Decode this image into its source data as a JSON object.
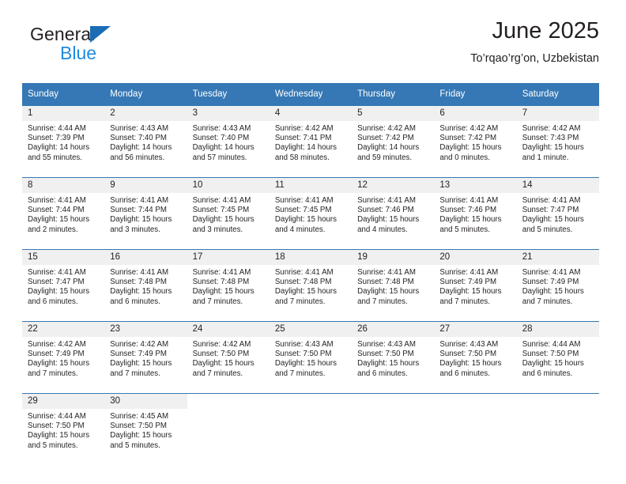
{
  "brand": {
    "name_top": "General",
    "name_bottom": "Blue",
    "triangle_color": "#1a6cb5",
    "blue_color": "#1f8ae0"
  },
  "header": {
    "title": "June 2025",
    "subtitle": "To’rqao’rg’on, Uzbekistan"
  },
  "theme": {
    "header_bg": "#3578b5",
    "daynum_bg": "#f0f0f0",
    "separator": "#3578b5",
    "text": "#231f20"
  },
  "calendar": {
    "weekday_headers": [
      "Sunday",
      "Monday",
      "Tuesday",
      "Wednesday",
      "Thursday",
      "Friday",
      "Saturday"
    ],
    "weeks": [
      [
        {
          "day": "1",
          "sunrise": "Sunrise: 4:44 AM",
          "sunset": "Sunset: 7:39 PM",
          "daylight1": "Daylight: 14 hours",
          "daylight2": "and 55 minutes."
        },
        {
          "day": "2",
          "sunrise": "Sunrise: 4:43 AM",
          "sunset": "Sunset: 7:40 PM",
          "daylight1": "Daylight: 14 hours",
          "daylight2": "and 56 minutes."
        },
        {
          "day": "3",
          "sunrise": "Sunrise: 4:43 AM",
          "sunset": "Sunset: 7:40 PM",
          "daylight1": "Daylight: 14 hours",
          "daylight2": "and 57 minutes."
        },
        {
          "day": "4",
          "sunrise": "Sunrise: 4:42 AM",
          "sunset": "Sunset: 7:41 PM",
          "daylight1": "Daylight: 14 hours",
          "daylight2": "and 58 minutes."
        },
        {
          "day": "5",
          "sunrise": "Sunrise: 4:42 AM",
          "sunset": "Sunset: 7:42 PM",
          "daylight1": "Daylight: 14 hours",
          "daylight2": "and 59 minutes."
        },
        {
          "day": "6",
          "sunrise": "Sunrise: 4:42 AM",
          "sunset": "Sunset: 7:42 PM",
          "daylight1": "Daylight: 15 hours",
          "daylight2": "and 0 minutes."
        },
        {
          "day": "7",
          "sunrise": "Sunrise: 4:42 AM",
          "sunset": "Sunset: 7:43 PM",
          "daylight1": "Daylight: 15 hours",
          "daylight2": "and 1 minute."
        }
      ],
      [
        {
          "day": "8",
          "sunrise": "Sunrise: 4:41 AM",
          "sunset": "Sunset: 7:44 PM",
          "daylight1": "Daylight: 15 hours",
          "daylight2": "and 2 minutes."
        },
        {
          "day": "9",
          "sunrise": "Sunrise: 4:41 AM",
          "sunset": "Sunset: 7:44 PM",
          "daylight1": "Daylight: 15 hours",
          "daylight2": "and 3 minutes."
        },
        {
          "day": "10",
          "sunrise": "Sunrise: 4:41 AM",
          "sunset": "Sunset: 7:45 PM",
          "daylight1": "Daylight: 15 hours",
          "daylight2": "and 3 minutes."
        },
        {
          "day": "11",
          "sunrise": "Sunrise: 4:41 AM",
          "sunset": "Sunset: 7:45 PM",
          "daylight1": "Daylight: 15 hours",
          "daylight2": "and 4 minutes."
        },
        {
          "day": "12",
          "sunrise": "Sunrise: 4:41 AM",
          "sunset": "Sunset: 7:46 PM",
          "daylight1": "Daylight: 15 hours",
          "daylight2": "and 4 minutes."
        },
        {
          "day": "13",
          "sunrise": "Sunrise: 4:41 AM",
          "sunset": "Sunset: 7:46 PM",
          "daylight1": "Daylight: 15 hours",
          "daylight2": "and 5 minutes."
        },
        {
          "day": "14",
          "sunrise": "Sunrise: 4:41 AM",
          "sunset": "Sunset: 7:47 PM",
          "daylight1": "Daylight: 15 hours",
          "daylight2": "and 5 minutes."
        }
      ],
      [
        {
          "day": "15",
          "sunrise": "Sunrise: 4:41 AM",
          "sunset": "Sunset: 7:47 PM",
          "daylight1": "Daylight: 15 hours",
          "daylight2": "and 6 minutes."
        },
        {
          "day": "16",
          "sunrise": "Sunrise: 4:41 AM",
          "sunset": "Sunset: 7:48 PM",
          "daylight1": "Daylight: 15 hours",
          "daylight2": "and 6 minutes."
        },
        {
          "day": "17",
          "sunrise": "Sunrise: 4:41 AM",
          "sunset": "Sunset: 7:48 PM",
          "daylight1": "Daylight: 15 hours",
          "daylight2": "and 7 minutes."
        },
        {
          "day": "18",
          "sunrise": "Sunrise: 4:41 AM",
          "sunset": "Sunset: 7:48 PM",
          "daylight1": "Daylight: 15 hours",
          "daylight2": "and 7 minutes."
        },
        {
          "day": "19",
          "sunrise": "Sunrise: 4:41 AM",
          "sunset": "Sunset: 7:48 PM",
          "daylight1": "Daylight: 15 hours",
          "daylight2": "and 7 minutes."
        },
        {
          "day": "20",
          "sunrise": "Sunrise: 4:41 AM",
          "sunset": "Sunset: 7:49 PM",
          "daylight1": "Daylight: 15 hours",
          "daylight2": "and 7 minutes."
        },
        {
          "day": "21",
          "sunrise": "Sunrise: 4:41 AM",
          "sunset": "Sunset: 7:49 PM",
          "daylight1": "Daylight: 15 hours",
          "daylight2": "and 7 minutes."
        }
      ],
      [
        {
          "day": "22",
          "sunrise": "Sunrise: 4:42 AM",
          "sunset": "Sunset: 7:49 PM",
          "daylight1": "Daylight: 15 hours",
          "daylight2": "and 7 minutes."
        },
        {
          "day": "23",
          "sunrise": "Sunrise: 4:42 AM",
          "sunset": "Sunset: 7:49 PM",
          "daylight1": "Daylight: 15 hours",
          "daylight2": "and 7 minutes."
        },
        {
          "day": "24",
          "sunrise": "Sunrise: 4:42 AM",
          "sunset": "Sunset: 7:50 PM",
          "daylight1": "Daylight: 15 hours",
          "daylight2": "and 7 minutes."
        },
        {
          "day": "25",
          "sunrise": "Sunrise: 4:43 AM",
          "sunset": "Sunset: 7:50 PM",
          "daylight1": "Daylight: 15 hours",
          "daylight2": "and 7 minutes."
        },
        {
          "day": "26",
          "sunrise": "Sunrise: 4:43 AM",
          "sunset": "Sunset: 7:50 PM",
          "daylight1": "Daylight: 15 hours",
          "daylight2": "and 6 minutes."
        },
        {
          "day": "27",
          "sunrise": "Sunrise: 4:43 AM",
          "sunset": "Sunset: 7:50 PM",
          "daylight1": "Daylight: 15 hours",
          "daylight2": "and 6 minutes."
        },
        {
          "day": "28",
          "sunrise": "Sunrise: 4:44 AM",
          "sunset": "Sunset: 7:50 PM",
          "daylight1": "Daylight: 15 hours",
          "daylight2": "and 6 minutes."
        }
      ],
      [
        {
          "day": "29",
          "sunrise": "Sunrise: 4:44 AM",
          "sunset": "Sunset: 7:50 PM",
          "daylight1": "Daylight: 15 hours",
          "daylight2": "and 5 minutes."
        },
        {
          "day": "30",
          "sunrise": "Sunrise: 4:45 AM",
          "sunset": "Sunset: 7:50 PM",
          "daylight1": "Daylight: 15 hours",
          "daylight2": "and 5 minutes."
        },
        {
          "day": "",
          "sunrise": "",
          "sunset": "",
          "daylight1": "",
          "daylight2": ""
        },
        {
          "day": "",
          "sunrise": "",
          "sunset": "",
          "daylight1": "",
          "daylight2": ""
        },
        {
          "day": "",
          "sunrise": "",
          "sunset": "",
          "daylight1": "",
          "daylight2": ""
        },
        {
          "day": "",
          "sunrise": "",
          "sunset": "",
          "daylight1": "",
          "daylight2": ""
        },
        {
          "day": "",
          "sunrise": "",
          "sunset": "",
          "daylight1": "",
          "daylight2": ""
        }
      ]
    ]
  }
}
